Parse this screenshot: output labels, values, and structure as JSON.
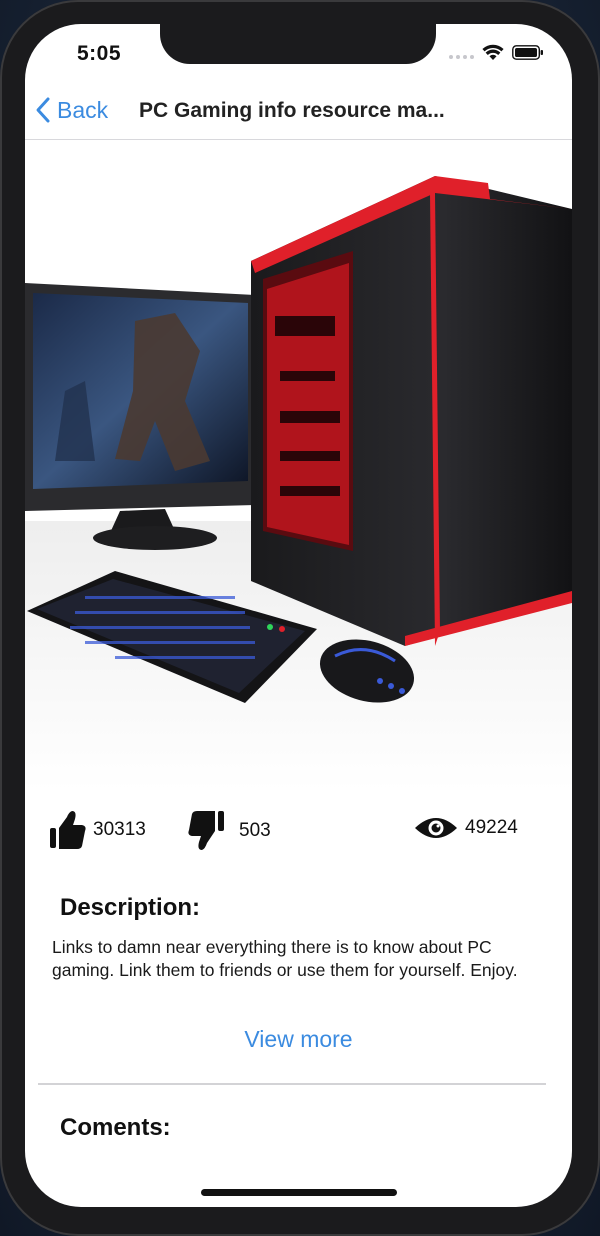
{
  "status_bar": {
    "time": "5:05"
  },
  "nav": {
    "back_label": "Back",
    "title": "PC Gaming info resource ma..."
  },
  "stats": {
    "likes": "30313",
    "dislikes": "503",
    "views": "49224"
  },
  "description": {
    "heading": "Description:",
    "text": "Links to damn near everything there is to know about PC gaming. Link them to friends or use them for yourself. Enjoy.",
    "view_more": "View more"
  },
  "comments": {
    "heading": "Coments:"
  },
  "colors": {
    "accent": "#3b8be0",
    "case_red": "#e0202a"
  }
}
